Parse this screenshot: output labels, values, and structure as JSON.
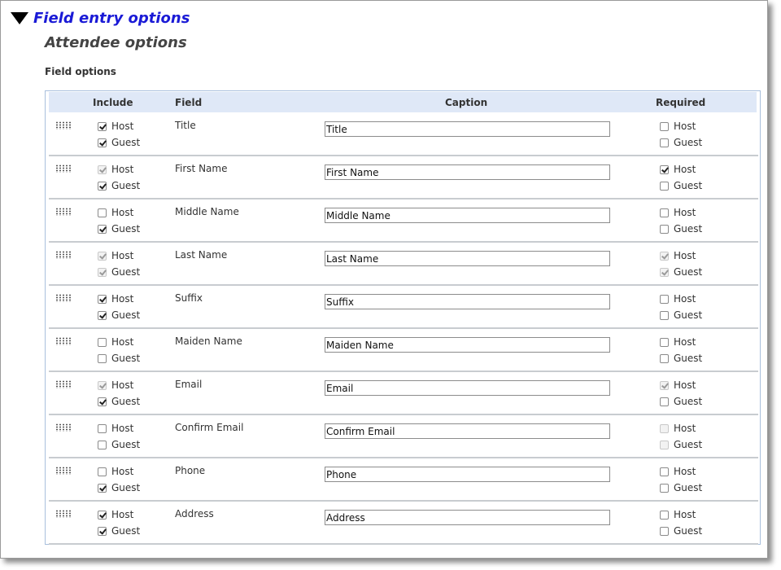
{
  "section": {
    "title": "Field entry options"
  },
  "subsection": {
    "title": "Attendee options"
  },
  "field_options_label": "Field options",
  "table": {
    "headers": {
      "include": "Include",
      "field": "Field",
      "caption": "Caption",
      "required": "Required"
    },
    "host_label": "Host",
    "guest_label": "Guest",
    "rows": [
      {
        "field": "Title",
        "caption": "Title",
        "include": {
          "host": {
            "checked": true,
            "disabled": false
          },
          "guest": {
            "checked": true,
            "disabled": false
          }
        },
        "required": {
          "host": {
            "checked": false,
            "disabled": false
          },
          "guest": {
            "checked": false,
            "disabled": false
          }
        }
      },
      {
        "field": "First Name",
        "caption": "First Name",
        "include": {
          "host": {
            "checked": true,
            "disabled": true
          },
          "guest": {
            "checked": true,
            "disabled": false
          }
        },
        "required": {
          "host": {
            "checked": true,
            "disabled": false
          },
          "guest": {
            "checked": false,
            "disabled": false
          }
        }
      },
      {
        "field": "Middle Name",
        "caption": "Middle Name",
        "include": {
          "host": {
            "checked": false,
            "disabled": false
          },
          "guest": {
            "checked": true,
            "disabled": false
          }
        },
        "required": {
          "host": {
            "checked": false,
            "disabled": false
          },
          "guest": {
            "checked": false,
            "disabled": false
          }
        }
      },
      {
        "field": "Last Name",
        "caption": "Last Name",
        "include": {
          "host": {
            "checked": true,
            "disabled": true
          },
          "guest": {
            "checked": true,
            "disabled": true
          }
        },
        "required": {
          "host": {
            "checked": true,
            "disabled": true
          },
          "guest": {
            "checked": true,
            "disabled": true
          }
        }
      },
      {
        "field": "Suffix",
        "caption": "Suffix",
        "include": {
          "host": {
            "checked": true,
            "disabled": false
          },
          "guest": {
            "checked": true,
            "disabled": false
          }
        },
        "required": {
          "host": {
            "checked": false,
            "disabled": false
          },
          "guest": {
            "checked": false,
            "disabled": false
          }
        }
      },
      {
        "field": "Maiden Name",
        "caption": "Maiden Name",
        "include": {
          "host": {
            "checked": false,
            "disabled": false
          },
          "guest": {
            "checked": false,
            "disabled": false
          }
        },
        "required": {
          "host": {
            "checked": false,
            "disabled": false
          },
          "guest": {
            "checked": false,
            "disabled": false
          }
        }
      },
      {
        "field": "Email",
        "caption": "Email",
        "include": {
          "host": {
            "checked": true,
            "disabled": true
          },
          "guest": {
            "checked": true,
            "disabled": false
          }
        },
        "required": {
          "host": {
            "checked": true,
            "disabled": true
          },
          "guest": {
            "checked": false,
            "disabled": false
          }
        }
      },
      {
        "field": "Confirm Email",
        "caption": "Confirm Email",
        "include": {
          "host": {
            "checked": false,
            "disabled": false
          },
          "guest": {
            "checked": false,
            "disabled": false
          }
        },
        "required": {
          "host": {
            "checked": false,
            "disabled": true
          },
          "guest": {
            "checked": false,
            "disabled": true
          }
        }
      },
      {
        "field": "Phone",
        "caption": "Phone",
        "include": {
          "host": {
            "checked": false,
            "disabled": false
          },
          "guest": {
            "checked": true,
            "disabled": false
          }
        },
        "required": {
          "host": {
            "checked": false,
            "disabled": false
          },
          "guest": {
            "checked": false,
            "disabled": false
          }
        }
      },
      {
        "field": "Address",
        "caption": "Address",
        "include": {
          "host": {
            "checked": true,
            "disabled": false
          },
          "guest": {
            "checked": true,
            "disabled": false
          }
        },
        "required": {
          "host": {
            "checked": false,
            "disabled": false
          },
          "guest": {
            "checked": false,
            "disabled": false
          }
        }
      }
    ]
  }
}
